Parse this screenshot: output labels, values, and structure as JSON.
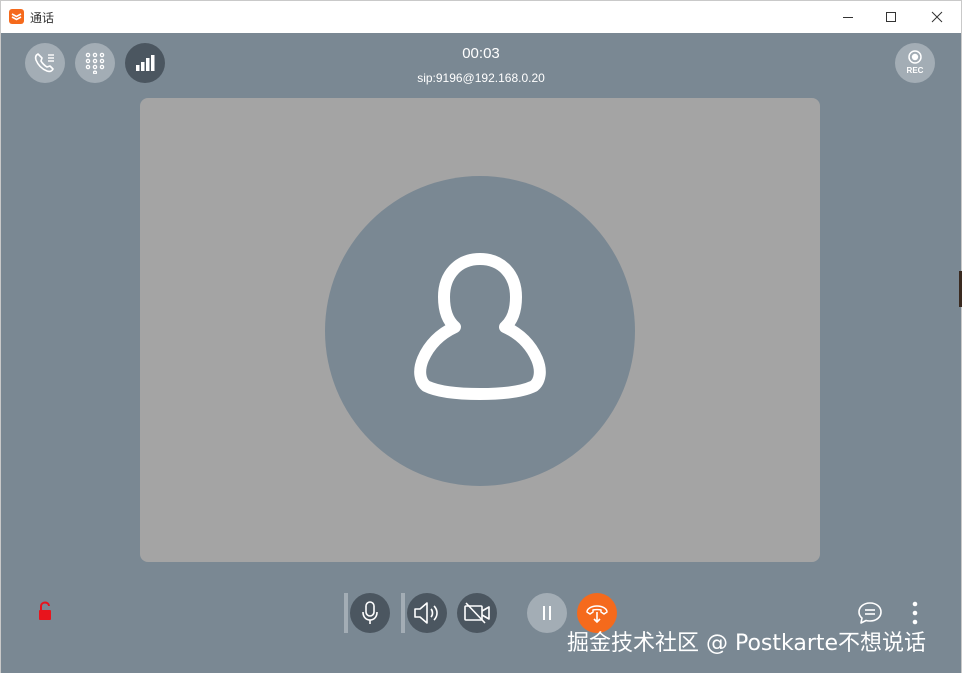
{
  "window": {
    "title": "通话"
  },
  "call": {
    "timer": "00:03",
    "sip_address": "sip:9196@192.168.0.20",
    "rec_label": "REC"
  },
  "toolbar_top": {
    "icons": [
      "call-list-icon",
      "dialpad-icon",
      "signal-icon",
      "record-icon"
    ]
  },
  "toolbar_bottom": {
    "icons": [
      "microphone-icon",
      "speaker-icon",
      "camera-off-icon",
      "pause-icon",
      "transfer-icon",
      "chat-icon",
      "more-icon",
      "lock-icon"
    ]
  },
  "watermark": "掘金技术社区 @ Postkarte不想说话",
  "colors": {
    "background": "#7a8893",
    "video_panel": "#a4a4a4",
    "accent": "#f56a1c",
    "lock": "#e8141c"
  }
}
